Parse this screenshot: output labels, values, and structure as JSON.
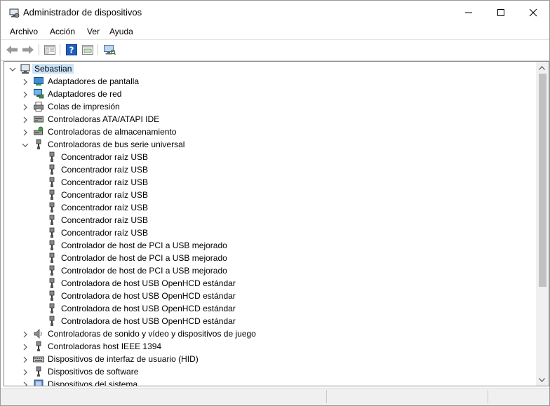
{
  "window": {
    "title": "Administrador de dispositivos"
  },
  "menu": [
    "Archivo",
    "Acción",
    "Ver",
    "Ayuda"
  ],
  "toolbar": [
    "back-icon",
    "forward-icon",
    "properties-icon",
    "help-icon",
    "update-driver-icon",
    "scan-hardware-icon"
  ],
  "tree": {
    "root": "Sebastian",
    "categories": [
      {
        "label": "Adaptadores de pantalla",
        "icon": "display-adapter-icon",
        "expanded": false
      },
      {
        "label": "Adaptadores de red",
        "icon": "network-adapter-icon",
        "expanded": false
      },
      {
        "label": "Colas de impresión",
        "icon": "printer-icon",
        "expanded": false
      },
      {
        "label": "Controladoras ATA/ATAPI IDE",
        "icon": "ide-controller-icon",
        "expanded": false
      },
      {
        "label": "Controladoras de almacenamiento",
        "icon": "storage-controller-icon",
        "expanded": false
      },
      {
        "label": "Controladoras de bus serie universal",
        "icon": "usb-icon",
        "expanded": true
      },
      {
        "label": "Controladoras de sonido y vídeo y dispositivos de juego",
        "icon": "speaker-icon",
        "expanded": false
      },
      {
        "label": "Controladoras host IEEE 1394",
        "icon": "ieee1394-icon",
        "expanded": false
      },
      {
        "label": "Dispositivos de interfaz de usuario (HID)",
        "icon": "hid-icon",
        "expanded": false
      },
      {
        "label": "Dispositivos de software",
        "icon": "software-device-icon",
        "expanded": false
      },
      {
        "label": "Dispositivos del sistema",
        "icon": "system-device-icon",
        "expanded": false
      }
    ],
    "usb_devices": [
      "Concentrador raíz USB",
      "Concentrador raíz USB",
      "Concentrador raíz USB",
      "Concentrador raíz USB",
      "Concentrador raíz USB",
      "Concentrador raíz USB",
      "Concentrador raíz USB",
      "Controlador de host de PCI a USB mejorado",
      "Controlador de host de PCI a USB mejorado",
      "Controlador de host de PCI a USB mejorado",
      "Controladora de host USB OpenHCD estándar",
      "Controladora de host USB OpenHCD estándar",
      "Controladora de host USB OpenHCD estándar",
      "Controladora de host USB OpenHCD estándar"
    ]
  },
  "colors": {
    "selection": "#cce4f7",
    "toolbar_blue": "#1f5fbf"
  }
}
